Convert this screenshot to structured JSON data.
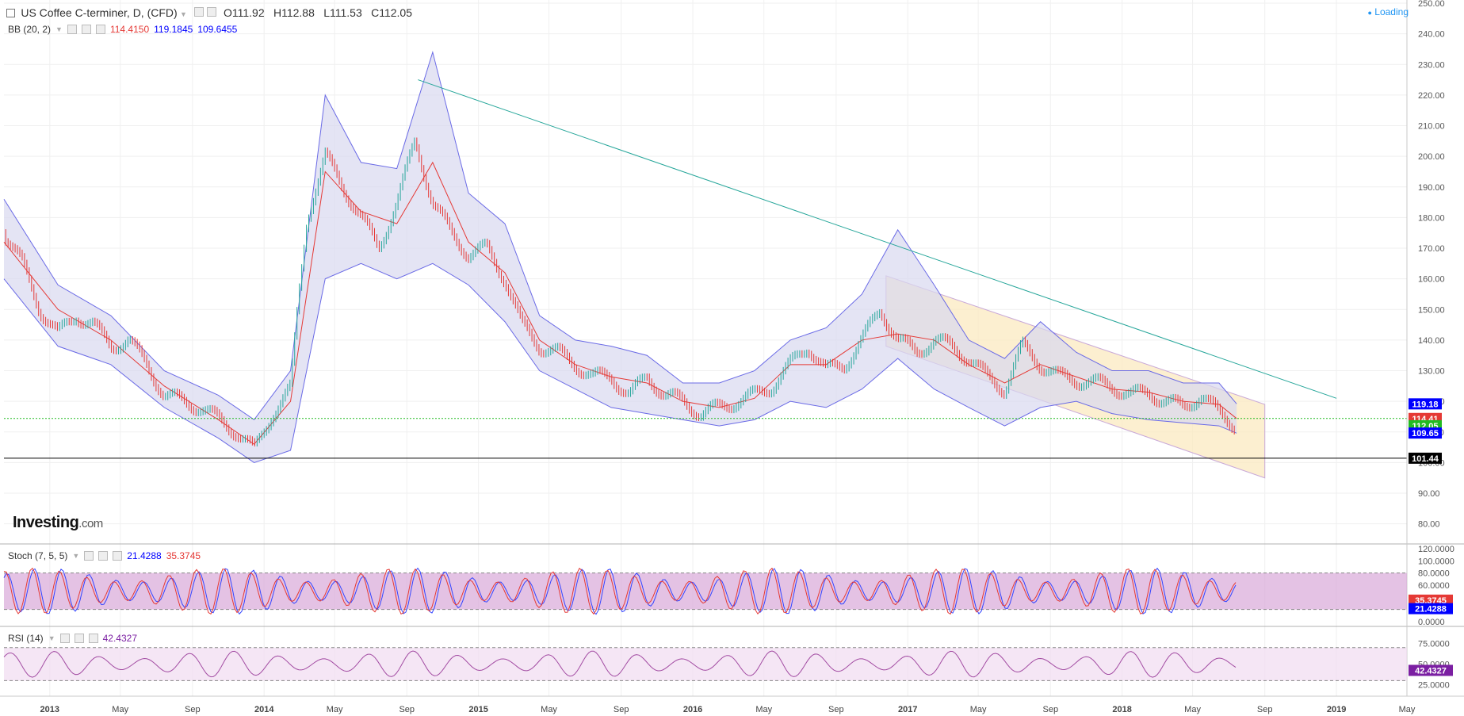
{
  "header": {
    "title": "US Coffee C-terminer, D, (CFD)",
    "open": "O111.92",
    "high": "H112.88",
    "low": "L111.53",
    "close": "C112.05",
    "status": "Loading"
  },
  "indicators": {
    "bb": {
      "label": "BB (20, 2)",
      "middle": "114.4150",
      "upper": "119.1845",
      "lower": "109.6455"
    },
    "stoch": {
      "label": "Stoch (7, 5, 5)",
      "k": "21.4288",
      "d": "35.3745"
    },
    "rsi": {
      "label": "RSI (14)",
      "value": "42.4327"
    }
  },
  "logo": {
    "name": "Investing",
    "suffix": ".com"
  },
  "colors": {
    "up": "#26a69a",
    "down": "#e53935",
    "bb_fill": "#d9d9f0",
    "bb_line": "#6a6ae6",
    "channel_fill": "#fbe9c0",
    "trend": "#26a69a",
    "stoch_fill": "#d9a8d9",
    "rsi_fill": "#f1dcf1"
  },
  "chart_data": {
    "type": "line",
    "price_axis": {
      "ylim": [
        75,
        250
      ],
      "ticks": [
        "80.00",
        "90.00",
        "100.00",
        "110.00",
        "120.00",
        "130.00",
        "140.00",
        "150.00",
        "160.00",
        "170.00",
        "180.00",
        "190.00",
        "200.00",
        "210.00",
        "220.00",
        "230.00",
        "240.00",
        "250.00"
      ]
    },
    "x_axis": {
      "labels": [
        "2013",
        "May",
        "Sep",
        "2014",
        "May",
        "Sep",
        "2015",
        "May",
        "Sep",
        "2016",
        "May",
        "Sep",
        "2017",
        "May",
        "Sep",
        "2018",
        "May",
        "Sep",
        "2019",
        "May"
      ],
      "label_dates": [
        "2013-01-01",
        "2013-05-01",
        "2013-09-01",
        "2014-01-01",
        "2014-05-01",
        "2014-09-01",
        "2015-01-01",
        "2015-05-01",
        "2015-09-01",
        "2016-01-01",
        "2016-05-01",
        "2016-09-01",
        "2017-01-01",
        "2017-05-01",
        "2017-09-01",
        "2018-01-01",
        "2018-05-01",
        "2018-09-01",
        "2019-01-01",
        "2019-05-01"
      ],
      "range": [
        "2012-10-15",
        "2019-05-01"
      ]
    },
    "series": [
      {
        "name": "",
        "role": "close",
        "x": [
          "2012-10-15",
          "2012-11-15",
          "2012-12-15",
          "2013-01-15",
          "2013-02-15",
          "2013-03-15",
          "2013-04-15",
          "2013-05-15",
          "2013-06-15",
          "2013-07-15",
          "2013-08-15",
          "2013-09-15",
          "2013-10-15",
          "2013-11-15",
          "2013-12-15",
          "2014-01-15",
          "2014-02-15",
          "2014-03-01",
          "2014-03-15",
          "2014-04-15",
          "2014-05-15",
          "2014-06-15",
          "2014-07-15",
          "2014-08-15",
          "2014-09-15",
          "2014-10-15",
          "2014-11-15",
          "2014-12-15",
          "2015-01-15",
          "2015-02-15",
          "2015-03-15",
          "2015-04-15",
          "2015-05-15",
          "2015-06-15",
          "2015-07-15",
          "2015-08-15",
          "2015-09-15",
          "2015-10-15",
          "2015-11-15",
          "2015-12-15",
          "2016-01-15",
          "2016-02-15",
          "2016-03-15",
          "2016-04-15",
          "2016-05-15",
          "2016-06-15",
          "2016-07-15",
          "2016-08-15",
          "2016-09-15",
          "2016-10-15",
          "2016-11-15",
          "2016-12-15",
          "2017-01-15",
          "2017-02-15",
          "2017-03-15",
          "2017-04-15",
          "2017-05-15",
          "2017-06-15",
          "2017-07-15",
          "2017-08-15",
          "2017-09-15",
          "2017-10-15",
          "2017-11-15",
          "2017-12-15",
          "2018-01-15",
          "2018-02-15",
          "2018-03-15",
          "2018-04-15",
          "2018-05-15",
          "2018-06-15",
          "2018-07-15"
        ],
        "y": [
          175,
          165,
          150,
          142,
          148,
          145,
          138,
          140,
          132,
          122,
          120,
          118,
          114,
          110,
          104,
          116,
          124,
          155,
          180,
          200,
          190,
          180,
          170,
          185,
          205,
          185,
          175,
          168,
          170,
          160,
          145,
          138,
          136,
          132,
          128,
          128,
          122,
          128,
          122,
          120,
          116,
          118,
          120,
          122,
          125,
          132,
          138,
          130,
          132,
          140,
          150,
          140,
          136,
          140,
          138,
          134,
          128,
          124,
          138,
          132,
          128,
          127,
          126,
          125,
          122,
          123,
          120,
          118,
          122,
          116,
          112
        ]
      },
      {
        "name": "",
        "role": "bb_middle",
        "x": [
          "2012-10-15",
          "2013-01-15",
          "2013-04-15",
          "2013-07-15",
          "2013-10-15",
          "2013-12-15",
          "2014-02-15",
          "2014-04-15",
          "2014-06-15",
          "2014-08-15",
          "2014-10-15",
          "2014-12-15",
          "2015-02-15",
          "2015-04-15",
          "2015-06-15",
          "2015-08-15",
          "2015-10-15",
          "2015-12-15",
          "2016-02-15",
          "2016-04-15",
          "2016-06-15",
          "2016-08-15",
          "2016-10-15",
          "2016-12-15",
          "2017-02-15",
          "2017-04-15",
          "2017-06-15",
          "2017-08-15",
          "2017-10-15",
          "2017-12-15",
          "2018-02-15",
          "2018-04-15",
          "2018-06-15",
          "2018-07-15"
        ],
        "y": [
          172,
          150,
          140,
          125,
          114,
          106,
          120,
          195,
          182,
          178,
          198,
          172,
          162,
          140,
          132,
          128,
          126,
          120,
          118,
          121,
          132,
          132,
          140,
          142,
          140,
          132,
          126,
          132,
          128,
          124,
          123,
          120,
          119,
          114.4
        ]
      },
      {
        "name": "",
        "role": "bb_upper",
        "x": [
          "2012-10-15",
          "2013-01-15",
          "2013-04-15",
          "2013-07-15",
          "2013-10-15",
          "2013-12-15",
          "2014-02-15",
          "2014-04-15",
          "2014-06-15",
          "2014-08-15",
          "2014-10-15",
          "2014-12-15",
          "2015-02-15",
          "2015-04-15",
          "2015-06-15",
          "2015-08-15",
          "2015-10-15",
          "2015-12-15",
          "2016-02-15",
          "2016-04-15",
          "2016-06-15",
          "2016-08-15",
          "2016-10-15",
          "2016-12-15",
          "2017-02-15",
          "2017-04-15",
          "2017-06-15",
          "2017-08-15",
          "2017-10-15",
          "2017-12-15",
          "2018-02-15",
          "2018-04-15",
          "2018-06-15",
          "2018-07-15"
        ],
        "y": [
          186,
          158,
          148,
          130,
          122,
          114,
          130,
          220,
          198,
          196,
          234,
          188,
          178,
          148,
          140,
          138,
          135,
          126,
          126,
          130,
          140,
          144,
          155,
          176,
          158,
          140,
          134,
          146,
          136,
          130,
          130,
          126,
          126,
          119.2
        ]
      },
      {
        "name": "",
        "role": "bb_lower",
        "x": [
          "2012-10-15",
          "2013-01-15",
          "2013-04-15",
          "2013-07-15",
          "2013-10-15",
          "2013-12-15",
          "2014-02-15",
          "2014-04-15",
          "2014-06-15",
          "2014-08-15",
          "2014-10-15",
          "2014-12-15",
          "2015-02-15",
          "2015-04-15",
          "2015-06-15",
          "2015-08-15",
          "2015-10-15",
          "2015-12-15",
          "2016-02-15",
          "2016-04-15",
          "2016-06-15",
          "2016-08-15",
          "2016-10-15",
          "2016-12-15",
          "2017-02-15",
          "2017-04-15",
          "2017-06-15",
          "2017-08-15",
          "2017-10-15",
          "2017-12-15",
          "2018-02-15",
          "2018-04-15",
          "2018-06-15",
          "2018-07-15"
        ],
        "y": [
          160,
          138,
          132,
          118,
          108,
          100,
          104,
          160,
          165,
          160,
          165,
          158,
          146,
          130,
          124,
          118,
          116,
          114,
          112,
          114,
          120,
          118,
          124,
          134,
          124,
          118,
          112,
          118,
          120,
          116,
          114,
          113,
          112,
          109.6
        ]
      }
    ],
    "lines": {
      "trendline": {
        "x": [
          "2014-09-20",
          "2019-01-01"
        ],
        "y": [
          225,
          121
        ]
      },
      "channel_upper": {
        "x": [
          "2016-11-25",
          "2018-09-01"
        ],
        "y": [
          161,
          119
        ]
      },
      "channel_lower": {
        "x": [
          "2016-11-25",
          "2018-09-01"
        ],
        "y": [
          138,
          95
        ]
      },
      "support": {
        "y": 101.44
      },
      "current": {
        "y": 114.41
      }
    },
    "price_labels": [
      {
        "value": "119.18",
        "y": 119.18,
        "color": "#0000ff"
      },
      {
        "value": "114.41",
        "y": 114.41,
        "color": "#e53935"
      },
      {
        "value": "112.05",
        "y": 112.05,
        "color": "#22bb22"
      },
      {
        "value": "109.65",
        "y": 109.65,
        "color": "#0000ff"
      },
      {
        "value": "101.44",
        "y": 101.44,
        "color": "#000000"
      }
    ],
    "stoch": {
      "ylim": [
        0,
        120
      ],
      "ticks": [
        "0.0000",
        "20.0000",
        "40.0000",
        "60.0000",
        "80.0000",
        "100.0000",
        "120.0000"
      ],
      "band": [
        20,
        80
      ],
      "last_k": 21.4288,
      "last_d": 35.3745,
      "labels": [
        {
          "value": "35.3745",
          "y": 35.3745,
          "color": "#e53935"
        },
        {
          "value": "21.4288",
          "y": 21.4288,
          "color": "#0000ff"
        }
      ]
    },
    "rsi": {
      "ylim": [
        15,
        90
      ],
      "ticks": [
        "25.0000",
        "50.0000",
        "75.0000"
      ],
      "band": [
        30,
        70
      ],
      "last": 42.4327,
      "labels": [
        {
          "value": "42.4327",
          "y": 42.4327,
          "color": "#7b1fa2"
        }
      ]
    }
  }
}
